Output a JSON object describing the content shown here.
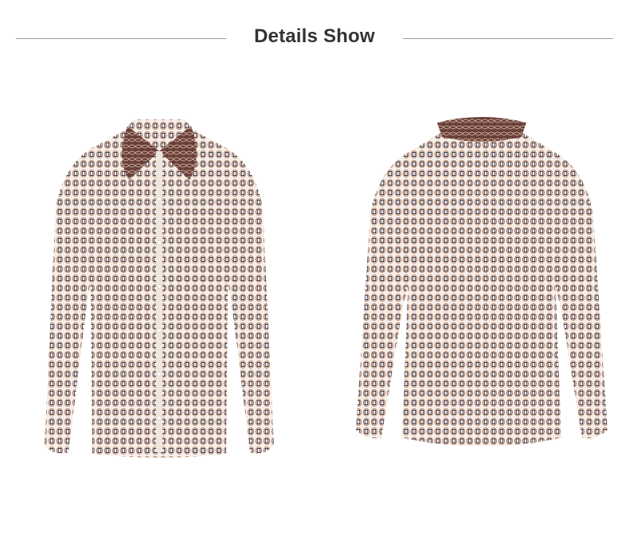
{
  "header": {
    "title": "Details Show"
  },
  "images": [
    {
      "name": "blouse-front-view",
      "pattern_colors": [
        "#f4efe9",
        "#5a3a36",
        "#b9876f",
        "#3d3d52"
      ]
    },
    {
      "name": "blouse-back-view",
      "pattern_colors": [
        "#f4efe9",
        "#5a3a36",
        "#b9876f",
        "#3d3d52"
      ]
    }
  ]
}
